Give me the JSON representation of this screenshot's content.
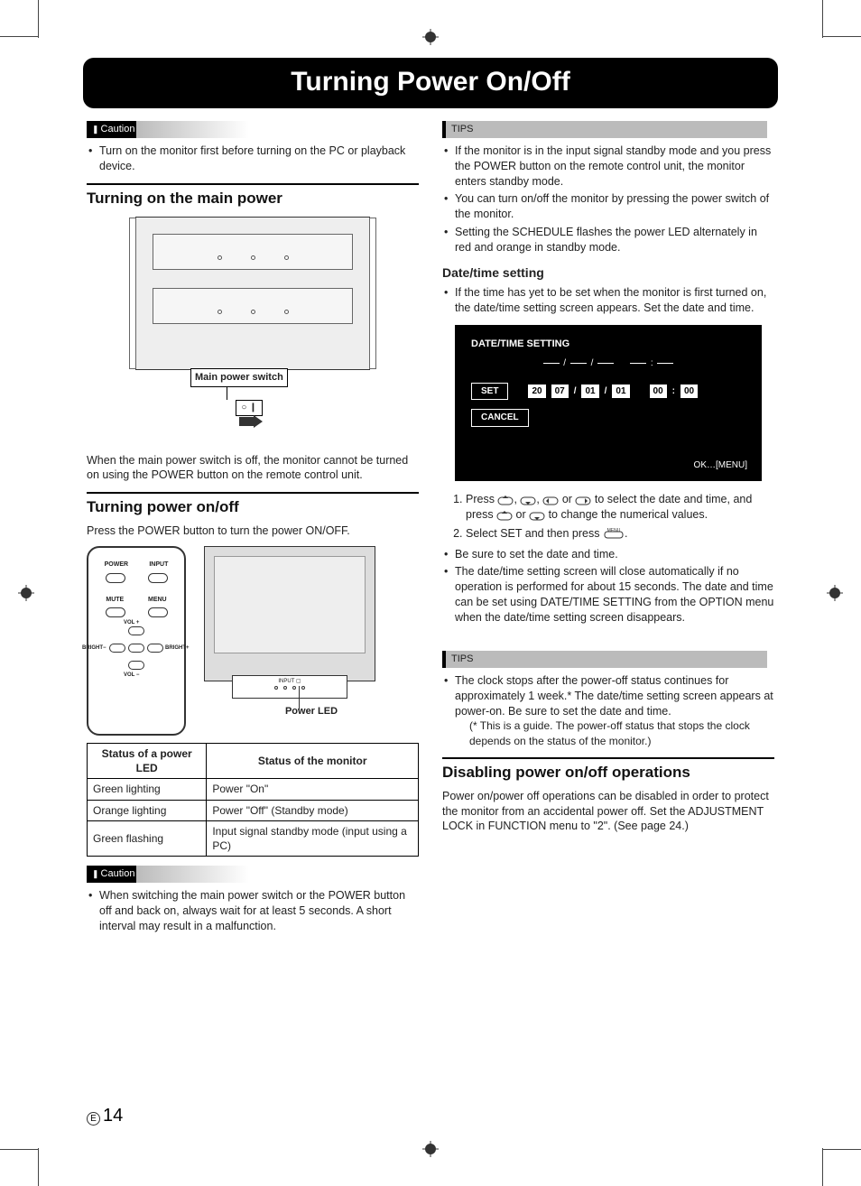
{
  "title": "Turning Power On/Off",
  "labels": {
    "caution": "Caution",
    "tips": "TIPS"
  },
  "left": {
    "caution1": "Turn on the monitor first before turning on the PC or playback device.",
    "h1": "Turning on the main power",
    "main_power_switch_label": "Main power switch",
    "main_power_note": "When the main power switch is off, the monitor cannot be turned on using the POWER button on the remote control unit.",
    "h2": "Turning power on/off",
    "press_power": "Press the POWER button to turn the power ON/OFF.",
    "remote": {
      "power": "POWER",
      "input": "INPUT",
      "mute": "MUTE",
      "menu": "MENU",
      "vol_plus": "VOL +",
      "vol_minus": "VOL −",
      "bright_minus": "BRIGHT−",
      "bright_plus": "BRIGHT+"
    },
    "monitor_bezel": "INPUT ▢",
    "power_led_label": "Power LED",
    "table": {
      "head_led": "Status of a power LED",
      "head_mon": "Status of the monitor",
      "rows": [
        {
          "led": "Green lighting",
          "mon": "Power \"On\""
        },
        {
          "led": "Orange lighting",
          "mon": "Power \"Off\" (Standby mode)"
        },
        {
          "led": "Green flashing",
          "mon": "Input signal standby mode (input using a PC)"
        }
      ]
    },
    "caution2": "When switching the main power switch or the POWER button off and back on, always wait for at least 5 seconds. A short interval may result in a malfunction."
  },
  "right": {
    "tips1": [
      "If the monitor is in the input signal standby mode and you press the POWER button on the remote control unit, the monitor enters standby mode.",
      "You can turn on/off the monitor by pressing the power switch of the monitor.",
      "Setting the SCHEDULE flashes the power LED alternately in red and orange in standby mode."
    ],
    "datetime_heading": "Date/time setting",
    "datetime_intro": "If the time has yet to be set when the monitor is first turned on, the date/time setting screen appears. Set the date and time.",
    "osd": {
      "title": "DATE/TIME SETTING",
      "set": "SET",
      "cancel": "CANCEL",
      "values": {
        "yy1": "20",
        "yy2": "07",
        "mm": "01",
        "dd": "01",
        "hh": "00",
        "mi": "00"
      },
      "ok": "OK…[MENU]"
    },
    "steps": [
      "Press ◄ , ► , ▲ or ▼ to select the date and time, and press ▲ or ▼ to change the numerical values.",
      "Select SET and then press MENU ."
    ],
    "post_steps": [
      "Be sure to set the date and time.",
      "The date/time setting screen will close automatically if no operation is performed for about 15 seconds. The date and time can be set using DATE/TIME SETTING from the OPTION menu when the date/time setting screen disappears."
    ],
    "tips2_main": "The clock stops after the power-off status continues for approximately 1 week.* The date/time setting screen appears at power-on. Be sure to set the date and time.",
    "tips2_note": "(* This is a guide. The power-off status that stops the clock depends on the status of the monitor.)",
    "disable_heading": "Disabling power on/off operations",
    "disable_body": "Power on/power off operations can be disabled in order to protect the monitor from an accidental power off. Set the ADJUSTMENT LOCK in FUNCTION menu to \"2\". (See page 24.)"
  },
  "page_marker": {
    "letter": "E",
    "number": "14"
  }
}
